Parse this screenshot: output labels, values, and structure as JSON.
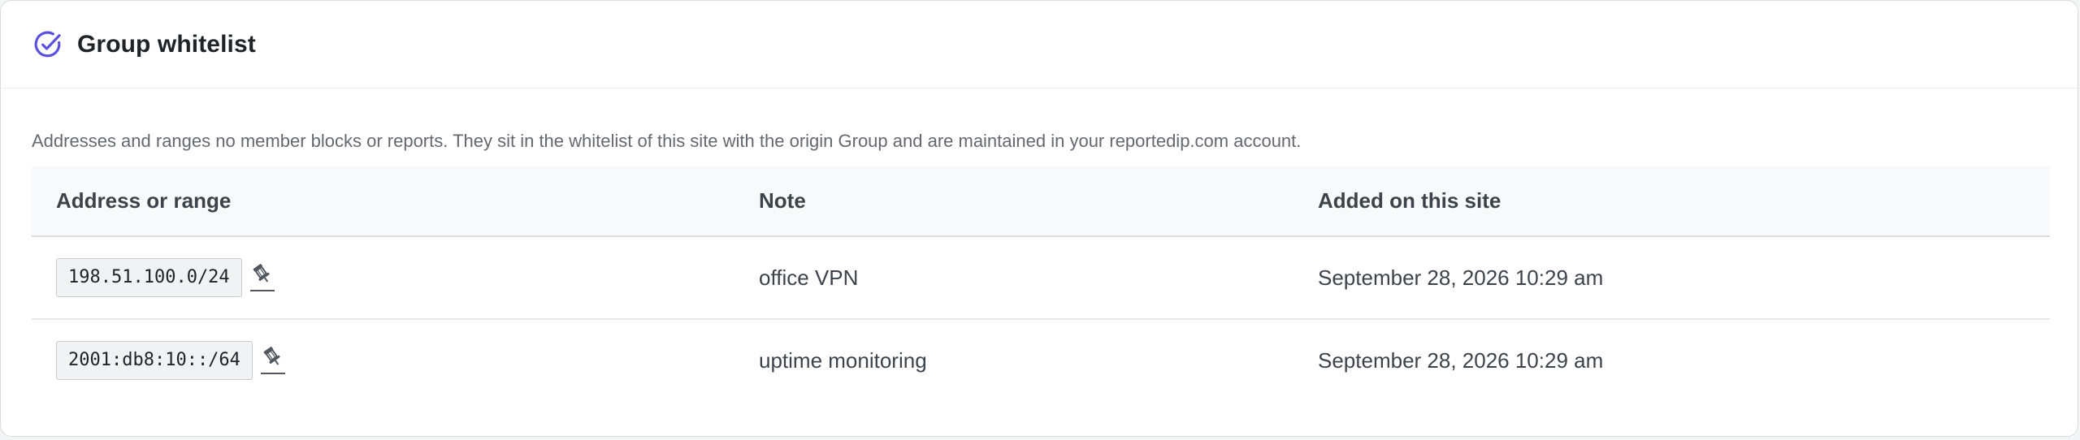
{
  "header": {
    "icon": "check-circle-icon",
    "title": "Group whitelist",
    "accent_color": "#5b4fe0"
  },
  "description": "Addresses and ranges no member blocks or reports. They sit in the whitelist of this site with the origin Group and are maintained in your reportedip.com account.",
  "table": {
    "columns": [
      "Address or range",
      "Note",
      "Added on this site"
    ],
    "rows": [
      {
        "address": "198.51.100.0/24",
        "address_icon": "pin-icon",
        "note": "office VPN",
        "added": "September 28, 2026 10:29 am"
      },
      {
        "address": "2001:db8:10::/64",
        "address_icon": "pin-icon",
        "note": "uptime monitoring",
        "added": "September 28, 2026 10:29 am"
      }
    ]
  }
}
